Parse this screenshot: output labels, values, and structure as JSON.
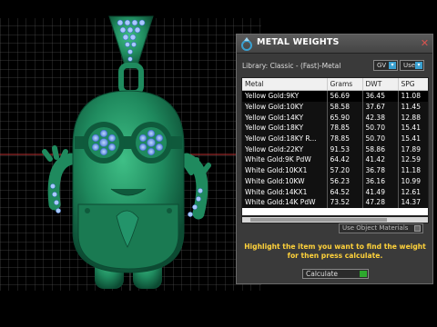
{
  "window": {
    "title": "METAL WEIGHTS",
    "close_glyph": "✕"
  },
  "library": "Library: Classic - (Fast)-Metal",
  "unit_selectors": [
    {
      "label": "GV",
      "button": "▾"
    },
    {
      "label": "User",
      "button": "▾"
    }
  ],
  "table": {
    "columns": [
      "Metal",
      "Grams",
      "DWT",
      "SPG"
    ],
    "rows": [
      {
        "metal": "Yellow Gold:9KY",
        "grams": "56.69",
        "dwt": "36.45",
        "spg": "11.08"
      },
      {
        "metal": "Yellow Gold:10KY",
        "grams": "58.58",
        "dwt": "37.67",
        "spg": "11.45"
      },
      {
        "metal": "Yellow Gold:14KY",
        "grams": "65.90",
        "dwt": "42.38",
        "spg": "12.88"
      },
      {
        "metal": "Yellow Gold:18KY",
        "grams": "78.85",
        "dwt": "50.70",
        "spg": "15.41"
      },
      {
        "metal": "Yellow Gold:18KY R...",
        "grams": "78.85",
        "dwt": "50.70",
        "spg": "15.41"
      },
      {
        "metal": "Yellow Gold:22KY",
        "grams": "91.53",
        "dwt": "58.86",
        "spg": "17.89"
      },
      {
        "metal": "White Gold:9K PdW",
        "grams": "64.42",
        "dwt": "41.42",
        "spg": "12.59"
      },
      {
        "metal": "White Gold:10KX1",
        "grams": "57.20",
        "dwt": "36.78",
        "spg": "11.18"
      },
      {
        "metal": "White Gold:10KW",
        "grams": "56.23",
        "dwt": "36.16",
        "spg": "10.99"
      },
      {
        "metal": "White Gold:14KX1",
        "grams": "64.52",
        "dwt": "41.49",
        "spg": "12.61"
      },
      {
        "metal": "White Gold:14K PdW",
        "grams": "73.52",
        "dwt": "47.28",
        "spg": "14.37"
      }
    ]
  },
  "use_object_materials": "Use Object Materials",
  "hint": "Highlight the item you want to find the weight for then press calculate.",
  "calculate": {
    "label": "Calculate",
    "selected_option": true
  },
  "colors": {
    "model": "#1f8a5e",
    "grid": "#5a5a5a",
    "accent": "#3aa0d0",
    "hint_text": "#ffd23a"
  }
}
